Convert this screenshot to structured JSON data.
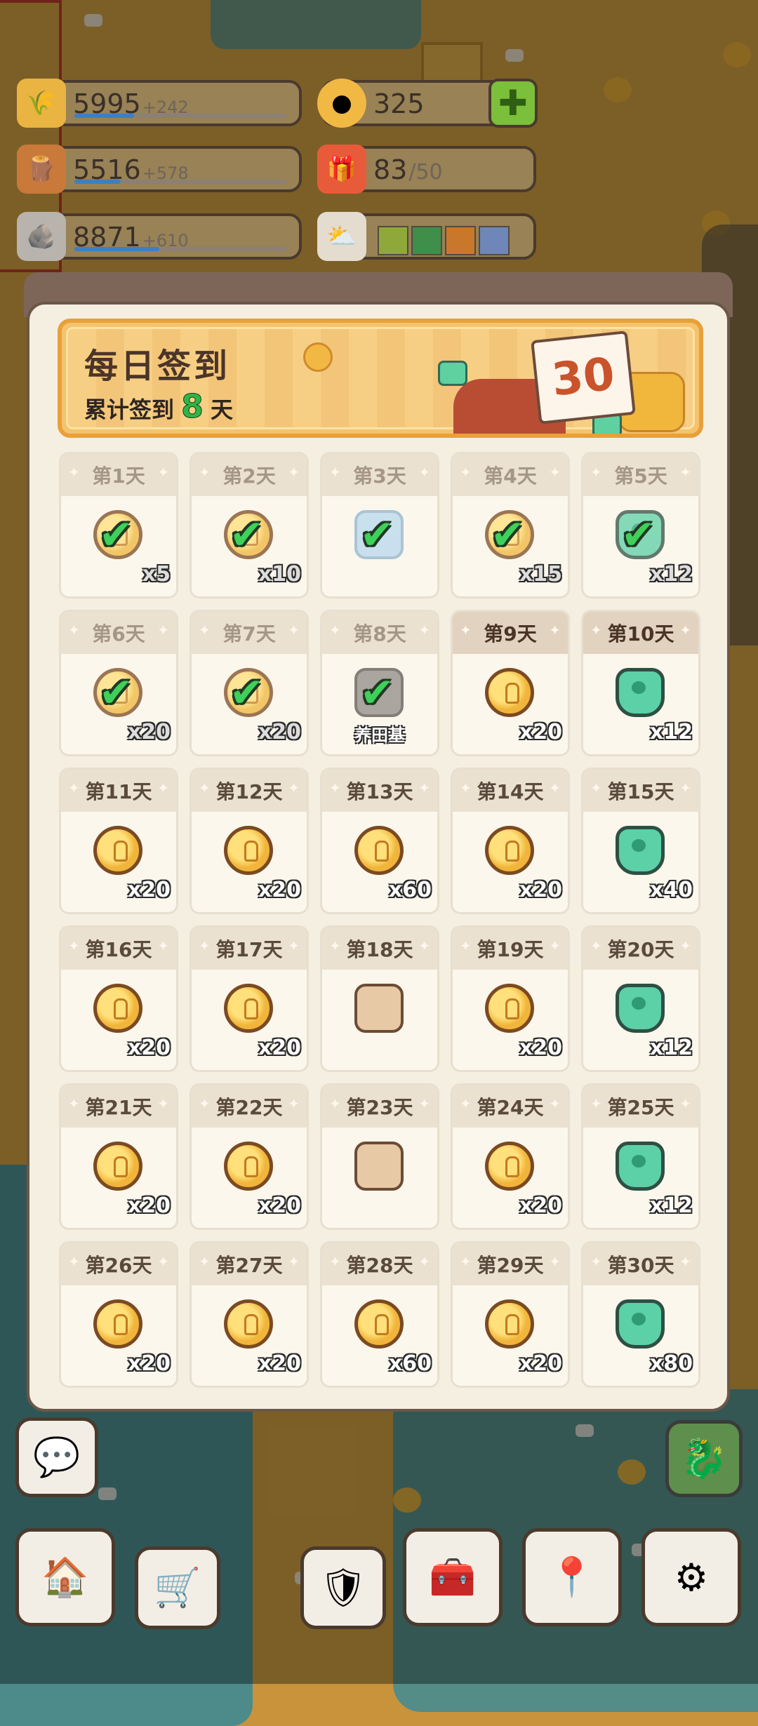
{
  "resources": [
    {
      "id": "wheat",
      "icon": "wheat-icon",
      "value": "5995",
      "increment": "+242",
      "progress": 0.28
    },
    {
      "id": "wood",
      "icon": "wood-icon",
      "value": "5516",
      "increment": "+578",
      "progress": 0.22
    },
    {
      "id": "stone",
      "icon": "stone-icon",
      "value": "8871",
      "increment": "+610",
      "progress": 0.4
    }
  ],
  "coins": {
    "value": "325",
    "icon": "coin-icon"
  },
  "gifts": {
    "value": "83",
    "max": "/50",
    "icon": "gift-icon"
  },
  "weather": {
    "icon": "weather-icon",
    "swatches": [
      "#8fa83a",
      "#3f8f4a",
      "#c9782b",
      "#6f86b8"
    ]
  },
  "checkin": {
    "title": "每日签到",
    "subtitle_prefix": "累计签到",
    "days_count": "8",
    "subtitle_suffix": "天",
    "calendar_number": "30"
  },
  "days": [
    {
      "label": "第1天",
      "type": "coin",
      "qty": "x5",
      "state": "claimed"
    },
    {
      "label": "第2天",
      "type": "coin",
      "qty": "x10",
      "state": "claimed"
    },
    {
      "label": "第3天",
      "type": "pet-frame",
      "qty": "",
      "state": "claimed"
    },
    {
      "label": "第4天",
      "type": "coin",
      "qty": "x15",
      "state": "claimed"
    },
    {
      "label": "第5天",
      "type": "gem",
      "qty": "x12",
      "state": "claimed"
    },
    {
      "label": "第6天",
      "type": "coin",
      "qty": "x20",
      "state": "claimed"
    },
    {
      "label": "第7天",
      "type": "coin",
      "qty": "x20",
      "state": "claimed"
    },
    {
      "label": "第8天",
      "type": "pet-gray",
      "qty": "",
      "name": "养田基",
      "state": "claimed"
    },
    {
      "label": "第9天",
      "type": "coin",
      "qty": "x20",
      "state": "today"
    },
    {
      "label": "第10天",
      "type": "gem",
      "qty": "x12",
      "state": "today"
    },
    {
      "label": "第11天",
      "type": "coin",
      "qty": "x20",
      "state": "locked"
    },
    {
      "label": "第12天",
      "type": "coin",
      "qty": "x20",
      "state": "locked"
    },
    {
      "label": "第13天",
      "type": "coin",
      "qty": "x60",
      "state": "locked"
    },
    {
      "label": "第14天",
      "type": "coin",
      "qty": "x20",
      "state": "locked"
    },
    {
      "label": "第15天",
      "type": "gem",
      "qty": "x40",
      "state": "locked"
    },
    {
      "label": "第16天",
      "type": "coin",
      "qty": "x20",
      "state": "locked"
    },
    {
      "label": "第17天",
      "type": "coin",
      "qty": "x20",
      "state": "locked"
    },
    {
      "label": "第18天",
      "type": "pet",
      "qty": "",
      "state": "locked"
    },
    {
      "label": "第19天",
      "type": "coin",
      "qty": "x20",
      "state": "locked"
    },
    {
      "label": "第20天",
      "type": "gem",
      "qty": "x12",
      "state": "locked"
    },
    {
      "label": "第21天",
      "type": "coin",
      "qty": "x20",
      "state": "locked"
    },
    {
      "label": "第22天",
      "type": "coin",
      "qty": "x20",
      "state": "locked"
    },
    {
      "label": "第23天",
      "type": "pet",
      "qty": "",
      "state": "locked"
    },
    {
      "label": "第24天",
      "type": "coin",
      "qty": "x20",
      "state": "locked"
    },
    {
      "label": "第25天",
      "type": "gem",
      "qty": "x12",
      "state": "locked"
    },
    {
      "label": "第26天",
      "type": "coin",
      "qty": "x20",
      "state": "locked"
    },
    {
      "label": "第27天",
      "type": "coin",
      "qty": "x20",
      "state": "locked"
    },
    {
      "label": "第28天",
      "type": "coin",
      "qty": "x60",
      "state": "locked"
    },
    {
      "label": "第29天",
      "type": "coin",
      "qty": "x20",
      "state": "locked"
    },
    {
      "label": "第30天",
      "type": "gem",
      "qty": "x80",
      "state": "locked"
    }
  ],
  "bottom_buttons": [
    {
      "id": "chat",
      "icon": "chat-icon"
    },
    {
      "id": "town",
      "icon": "town-return-icon"
    },
    {
      "id": "cart",
      "icon": "cart-icon"
    },
    {
      "id": "shield",
      "icon": "shield-icon"
    },
    {
      "id": "chest",
      "icon": "chest-icon"
    },
    {
      "id": "map",
      "icon": "map-pin-icon"
    },
    {
      "id": "settings",
      "icon": "gear-icon"
    },
    {
      "id": "dragon",
      "icon": "dragon-icon"
    }
  ]
}
